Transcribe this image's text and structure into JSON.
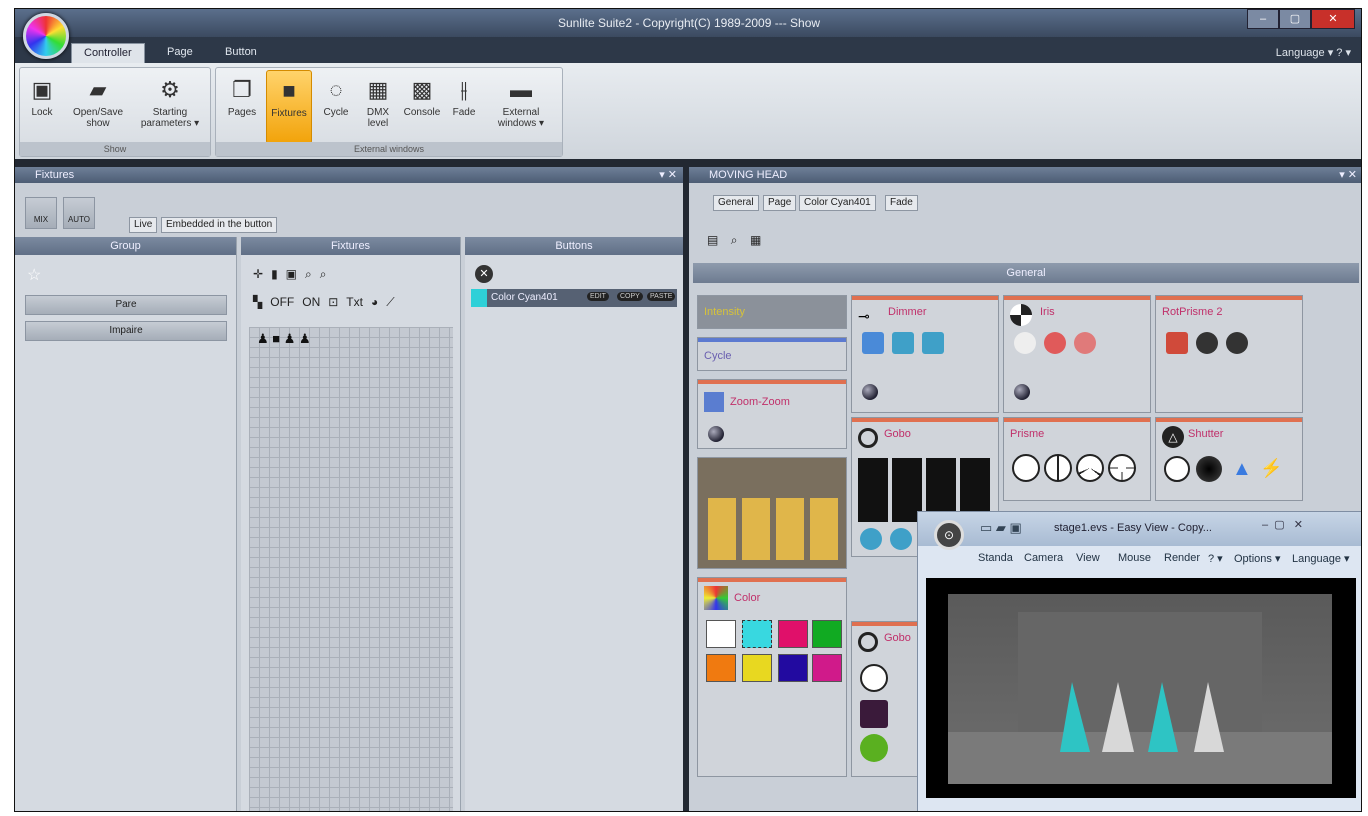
{
  "window": {
    "title": "Sunlite Suite2 - Copyright(C) 1989-2009 --- Show",
    "controls": {
      "min": "–",
      "max": "▢",
      "close": "✕"
    }
  },
  "menu": {
    "tabs": [
      "Controller",
      "Page",
      "Button"
    ],
    "language": "Language ▾ ? ▾"
  },
  "ribbon": {
    "show_group": {
      "label": "Show",
      "lock": "Lock",
      "open_save": "Open/Save show",
      "starting": "Starting parameters ▾"
    },
    "external_group": {
      "label": "External windows",
      "pages": "Pages",
      "fixtures": "Fixtures",
      "cycle": "Cycle",
      "dmx": "DMX level",
      "console": "Console",
      "fade": "Fade",
      "external": "External windows ▾"
    }
  },
  "fixtures_panel": {
    "title": "Fixtures",
    "tabs": [
      "Live",
      "Embedded in the button"
    ],
    "small_btns": [
      "MIX",
      "AUTO"
    ],
    "group_col": {
      "header": "Group",
      "items": [
        "Pare",
        "Impaire"
      ]
    },
    "fixtures_col": {
      "header": "Fixtures",
      "off": "OFF",
      "on": "ON",
      "txt": "Txt"
    },
    "buttons_col": {
      "header": "Buttons",
      "button_name": "Color Cyan401",
      "button_color": "#2ed0d8",
      "mini": [
        "EDIT",
        "COPY",
        "PASTE"
      ]
    }
  },
  "moving_head": {
    "title": "MOVING HEAD",
    "tabs": [
      "General",
      "Page",
      "Color Cyan401",
      "Fade"
    ],
    "section": "General",
    "left_items": [
      "Intensity",
      "Cycle",
      "Zoom-Zoom"
    ],
    "boxes": [
      "Dimmer",
      "Iris",
      "RotPrisme 2",
      "Gobo",
      "Prisme",
      "Shutter",
      "Color",
      "Gobo"
    ]
  },
  "easy_view": {
    "title": "stage1.evs - Easy View - Copy...",
    "menu": [
      "Standa",
      "Camera",
      "View",
      "Mouse",
      "Render",
      "? ▾",
      "Options ▾",
      "Language ▾"
    ],
    "beam_colors": [
      "#2ec4c4",
      "#d8d8d8",
      "#2ec4c4",
      "#d8d8d8"
    ]
  },
  "colors": {
    "swatches": [
      "#ffffff",
      "#38d8e0",
      "#e0106a",
      "#11aa22",
      "#f07a10",
      "#e8d820",
      "#220aa0",
      "#d01a8a"
    ]
  }
}
